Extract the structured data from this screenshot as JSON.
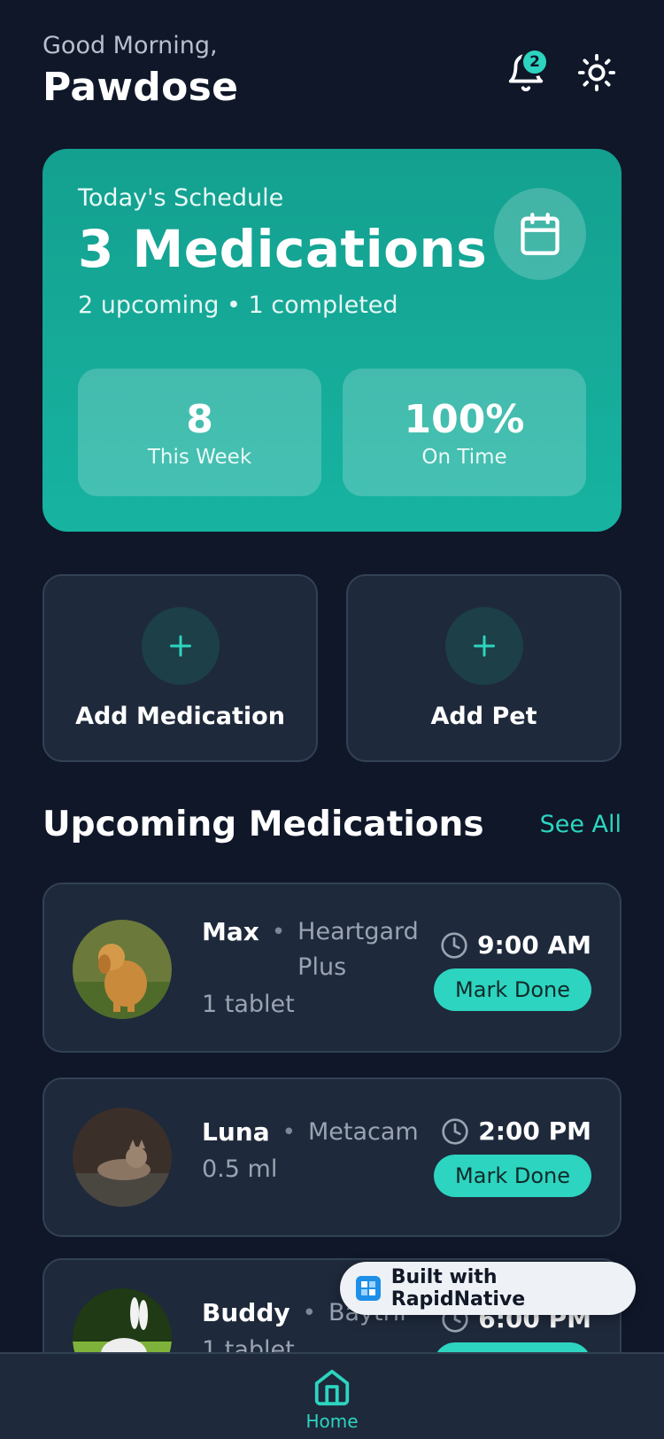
{
  "header": {
    "greeting": "Good Morning,",
    "title": "Pawdose",
    "notification_count": "2",
    "icons": [
      "bell-icon",
      "sun-icon"
    ]
  },
  "schedule": {
    "label": "Today's Schedule",
    "count": "3 Medications",
    "summary": "2 upcoming • 1 completed",
    "icon": "calendar-icon",
    "stats": [
      {
        "value": "8",
        "label": "This Week"
      },
      {
        "value": "100%",
        "label": "On Time"
      }
    ]
  },
  "quick_actions": [
    {
      "label": "Add Medication",
      "icon": "plus-icon"
    },
    {
      "label": "Add Pet",
      "icon": "plus-icon"
    }
  ],
  "upcoming": {
    "title": "Upcoming Medications",
    "see_all": "See All",
    "items": [
      {
        "pet": "Max",
        "drug": "Heartgard Plus",
        "dose": "1 tablet",
        "time": "9:00 AM",
        "action": "Mark Done"
      },
      {
        "pet": "Luna",
        "drug": "Metacam",
        "dose": "0.5 ml",
        "time": "2:00 PM",
        "action": "Mark Done"
      },
      {
        "pet": "Buddy",
        "drug": "Baytril",
        "dose": "1 tablet",
        "time": "6:00 PM",
        "action": "Mark Done"
      }
    ]
  },
  "badge": {
    "text": "Built with RapidNative"
  },
  "tabbar": {
    "home_label": "Home"
  },
  "colors": {
    "background": "#0f1729",
    "accent": "#2dd4bf",
    "card": "#1e293b",
    "schedule_card": "#14a08f"
  }
}
